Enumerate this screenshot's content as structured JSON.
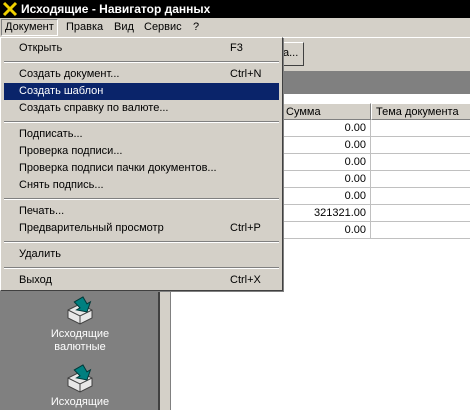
{
  "window": {
    "title": "Исходящие - Навигатор данных"
  },
  "menubar": {
    "items": [
      "Документ",
      "Правка",
      "Вид",
      "Сервис",
      "?"
    ]
  },
  "toolbar": {
    "button_label": "а..."
  },
  "menu": {
    "items": [
      {
        "label": "Открыть",
        "shortcut": "F3"
      },
      {
        "label": "Создать документ...",
        "shortcut": "Ctrl+N"
      },
      {
        "label": "Создать шаблон",
        "shortcut": ""
      },
      {
        "label": "Создать справку по валюте...",
        "shortcut": ""
      },
      {
        "label": "Подписать...",
        "shortcut": ""
      },
      {
        "label": "Проверка подписи...",
        "shortcut": ""
      },
      {
        "label": "Проверка подписи пачки документов...",
        "shortcut": ""
      },
      {
        "label": "Снять подпись...",
        "shortcut": ""
      },
      {
        "label": "Печать...",
        "shortcut": ""
      },
      {
        "label": "Предварительный просмотр",
        "shortcut": "Ctrl+P"
      },
      {
        "label": "Удалить",
        "shortcut": ""
      },
      {
        "label": "Выход",
        "shortcut": "Ctrl+X"
      }
    ],
    "highlighted_index": 2
  },
  "grid": {
    "columns": [
      "Сумма",
      "Тема документа"
    ],
    "rows": [
      {
        "sum": "0.00",
        "subject": ""
      },
      {
        "sum": "0.00",
        "subject": ""
      },
      {
        "sum": "0.00",
        "subject": ""
      },
      {
        "sum": "0.00",
        "subject": ""
      },
      {
        "sum": "0.00",
        "subject": ""
      },
      {
        "sum": "321321.00",
        "subject": ""
      },
      {
        "sum": "0.00",
        "subject": ""
      }
    ]
  },
  "navigator": {
    "items": [
      {
        "label_line1": "Исходящие",
        "label_line2": "валютные"
      },
      {
        "label_line1": "Исходящие",
        "label_line2": ""
      }
    ]
  },
  "colors": {
    "highlight": "#0a246a",
    "chrome": "#d4d0c8",
    "pane": "#808080"
  }
}
